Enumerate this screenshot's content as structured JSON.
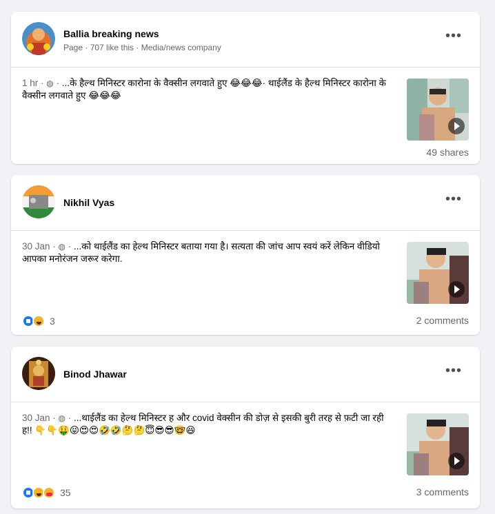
{
  "posts": [
    {
      "author": "Ballia breaking news",
      "meta": "Page · 707 like this · Media/news company",
      "timestamp": "1 hr",
      "text": "...के हैल्थ मिनिस्टर कारोना के वैक्सीन लगवाते हुए 😂😂😂· थाईलैंड के हैल्थ मिनिस्टर कारोना के वैक्सीन लगवाते हुए 😂😂😂",
      "footer_right": "49 shares",
      "reactions": [],
      "reaction_count": ""
    },
    {
      "author": "Nikhil Vyas",
      "meta": "",
      "timestamp": "30 Jan",
      "text": "...को थाईलैंड का हेल्थ मिनिस्टर बताया गया है। सत्यता की जांच आप स्वयं करें लेकिन वीडियो आपका मनोरंजन जरूर करेगा.",
      "footer_right": "2 comments",
      "reactions": [
        "like-reaction-icon",
        "haha-reaction-icon"
      ],
      "reaction_count": "3"
    },
    {
      "author": "Binod Jhawar",
      "meta": "",
      "timestamp": "30 Jan",
      "text": "...थाईलैंड का हेल्थ मिनिस्टर ह और covid वेक्सीन की डोज़ से इसकी बुरी तरह से फ़टी जा रही ह!! 👇👇🤑😝😍😍🤣🤣🤔🤔😇😎😎🤓😆",
      "footer_right": "3 comments",
      "reactions": [
        "like-reaction-icon",
        "haha-reaction-icon",
        "care-reaction-icon"
      ],
      "reaction_count": "35"
    }
  ],
  "icons": {
    "globe": "globe-icon",
    "more": "more-options-icon",
    "play": "play-icon"
  },
  "colors": {
    "background": "#f0f2f5",
    "card": "#ffffff",
    "secondary_text": "#65676b",
    "like_blue": "#1877f2",
    "haha_yellow": "#f7b125"
  }
}
